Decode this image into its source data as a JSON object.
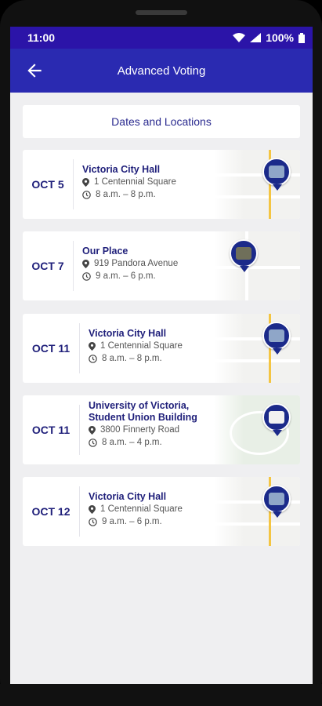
{
  "status": {
    "time": "11:00",
    "battery": "100%"
  },
  "appbar": {
    "title": "Advanced Voting"
  },
  "section": {
    "title": "Dates and Locations"
  },
  "cards": [
    {
      "date": "OCT 5",
      "place": "Victoria City Hall",
      "address": "1 Centennial Square",
      "hours": "8 a.m. – 8 p.m."
    },
    {
      "date": "OCT 7",
      "place": "Our Place",
      "address": "919 Pandora Avenue",
      "hours": "9 a.m. – 6 p.m."
    },
    {
      "date": "OCT 11",
      "place": "Victoria City Hall",
      "address": "1 Centennial Square",
      "hours": "8 a.m. – 8 p.m."
    },
    {
      "date": "OCT 11",
      "place": "University of Victoria, Student Union Building",
      "address": "3800 Finnerty Road",
      "hours": "8 a.m. – 4 p.m."
    },
    {
      "date": "OCT 12",
      "place": "Victoria City Hall",
      "address": "1 Centennial Square",
      "hours": "9 a.m. – 6 p.m."
    }
  ]
}
